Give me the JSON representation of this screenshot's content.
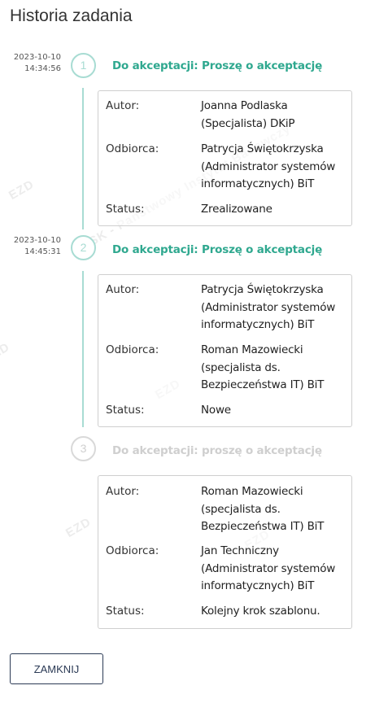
{
  "title": "Historia zadania",
  "labels": {
    "author": "Autor:",
    "recipient": "Odbiorca:",
    "status": "Status:"
  },
  "watermark": {
    "logo": "EZD",
    "org": "NASK - Państwowy Instytut Badawczy"
  },
  "steps": [
    {
      "number": "1",
      "date": "2023-10-10",
      "time": "14:34:56",
      "title": "Do akceptacji: Proszę o akceptację",
      "author": [
        "Joanna Podlaska",
        "(Specjalista) DKiP"
      ],
      "recipient": [
        "Patrycja Świętokrzyska",
        "(Administrator systemów",
        "informatycznych) BiT"
      ],
      "status": "Zrealizowane"
    },
    {
      "number": "2",
      "date": "2023-10-10",
      "time": "14:45:31",
      "title": "Do akceptacji: Proszę o akceptację",
      "author": [
        "Patrycja Świętokrzyska",
        "(Administrator systemów",
        "informatycznych) BiT"
      ],
      "recipient": [
        "Roman Mazowiecki",
        "(specjalista ds.",
        "Bezpieczeństwa IT) BiT"
      ],
      "status": "Nowe"
    },
    {
      "number": "3",
      "title": "Do akceptacji: proszę o akceptację",
      "author": [
        "Roman Mazowiecki",
        "(specjalista ds.",
        "Bezpieczeństwa IT) BiT"
      ],
      "recipient": [
        "Jan Techniczny",
        "(Administrator systemów",
        "informatycznych) BiT"
      ],
      "status": "Kolejny krok szablonu."
    }
  ],
  "close_button": "ZAMKNIJ"
}
